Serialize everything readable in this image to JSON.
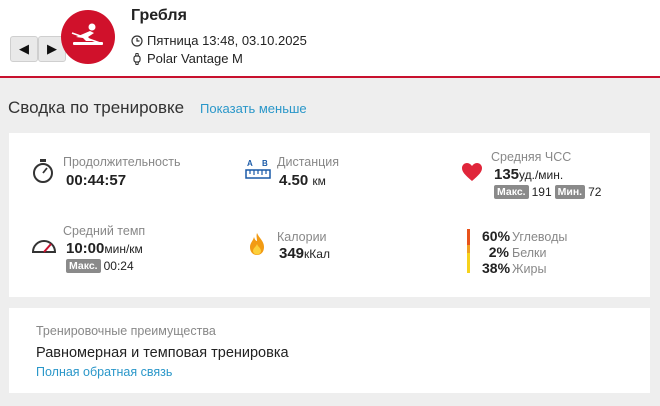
{
  "header": {
    "title": "Гребля",
    "datetime": "Пятница 13:48, 03.10.2025",
    "device": "Polar Vantage M",
    "prev_label": "◀",
    "next_label": "▶",
    "sport_icon": "rowing-icon",
    "accent_color": "#d0112b"
  },
  "section": {
    "title": "Сводка по тренировке",
    "toggle_label": "Показать меньше"
  },
  "summary": {
    "duration": {
      "label": "Продолжительность",
      "value": "00:44:57",
      "icon": "stopwatch-icon"
    },
    "distance": {
      "label": "Дистанция",
      "value": "4.50",
      "unit": "км",
      "icon": "distance-ruler-icon"
    },
    "avg_hr": {
      "label": "Средняя ЧСС",
      "value": "135",
      "unit": "уд./мин.",
      "max_label": "Макс.",
      "max_value": "191",
      "min_label": "Мин.",
      "min_value": "72",
      "icon": "heart-icon"
    },
    "avg_pace": {
      "label": "Средний темп",
      "value": "10:00",
      "unit": "мин/км",
      "max_label": "Макс.",
      "max_value": "00:24",
      "icon": "speedometer-icon"
    },
    "calories": {
      "label": "Калории",
      "value": "349",
      "unit": "кКал",
      "icon": "flame-icon"
    },
    "macros": [
      {
        "percent": "60%",
        "label": "Углеводы",
        "color": "#e8531b"
      },
      {
        "percent": "2%",
        "label": "Белки",
        "color": "#f0a020"
      },
      {
        "percent": "38%",
        "label": "Жиры",
        "color": "#f6d21c"
      }
    ]
  },
  "benefit": {
    "label": "Тренировочные преимущества",
    "value": "Равномерная и темповая тренировка",
    "link": "Полная обратная связь"
  }
}
